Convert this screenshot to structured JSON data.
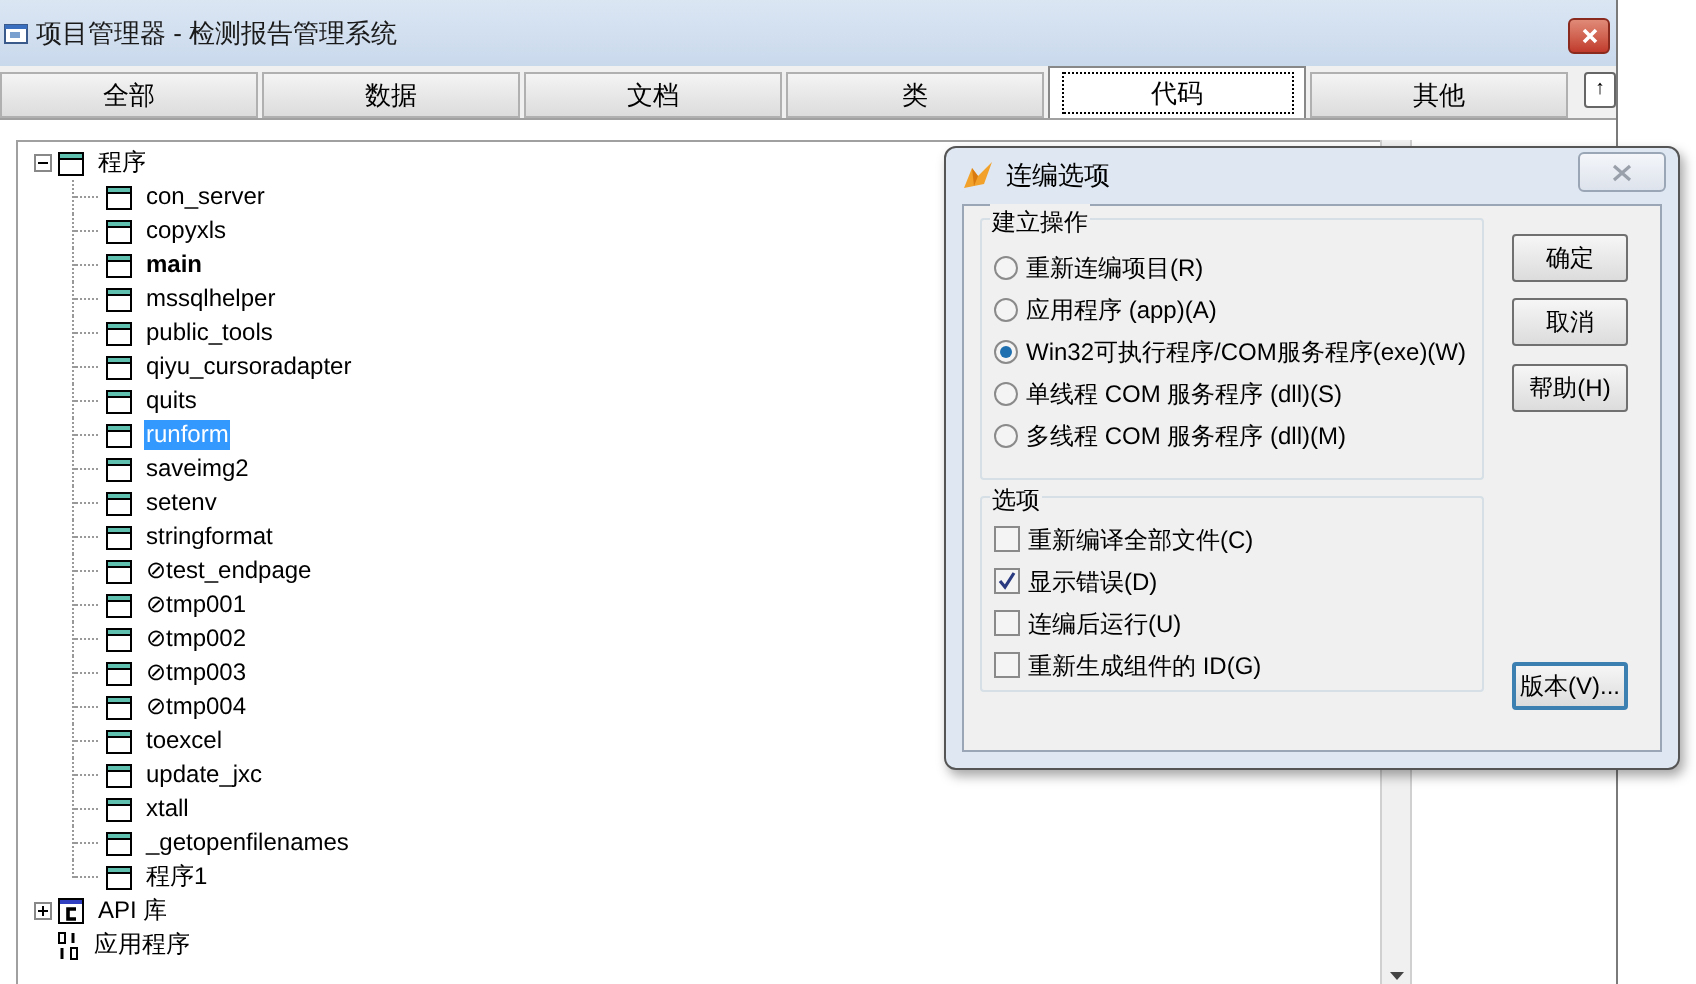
{
  "window": {
    "title": "项目管理器 - 检测报告管理系统"
  },
  "tabs": [
    {
      "label": "全部",
      "selected": false
    },
    {
      "label": "数据",
      "selected": false
    },
    {
      "label": "文档",
      "selected": false
    },
    {
      "label": "类",
      "selected": false
    },
    {
      "label": "代码",
      "selected": true
    },
    {
      "label": "其他",
      "selected": false
    }
  ],
  "collapse_button": {
    "label": "↑"
  },
  "tree": [
    {
      "label": "程序",
      "kind": "folder",
      "expanded": true,
      "selected": false,
      "bold": false,
      "children": [
        {
          "label": "con_server",
          "kind": "program",
          "selected": false,
          "bold": false
        },
        {
          "label": "copyxls",
          "kind": "program",
          "selected": false,
          "bold": false
        },
        {
          "label": "main",
          "kind": "program",
          "selected": false,
          "bold": true
        },
        {
          "label": "mssqlhelper",
          "kind": "program",
          "selected": false,
          "bold": false
        },
        {
          "label": "public_tools",
          "kind": "program",
          "selected": false,
          "bold": false
        },
        {
          "label": "qiyu_cursoradapter",
          "kind": "program",
          "selected": false,
          "bold": false
        },
        {
          "label": "quits",
          "kind": "program",
          "selected": false,
          "bold": false
        },
        {
          "label": "runform",
          "kind": "program",
          "selected": true,
          "bold": false
        },
        {
          "label": "saveimg2",
          "kind": "program",
          "selected": false,
          "bold": false
        },
        {
          "label": "setenv",
          "kind": "program",
          "selected": false,
          "bold": false
        },
        {
          "label": "stringformat",
          "kind": "program",
          "selected": false,
          "bold": false
        },
        {
          "label": "⊘test_endpage",
          "kind": "program",
          "selected": false,
          "bold": false
        },
        {
          "label": "⊘tmp001",
          "kind": "program",
          "selected": false,
          "bold": false
        },
        {
          "label": "⊘tmp002",
          "kind": "program",
          "selected": false,
          "bold": false
        },
        {
          "label": "⊘tmp003",
          "kind": "program",
          "selected": false,
          "bold": false
        },
        {
          "label": "⊘tmp004",
          "kind": "program",
          "selected": false,
          "bold": false
        },
        {
          "label": "toexcel",
          "kind": "program",
          "selected": false,
          "bold": false
        },
        {
          "label": "update_jxc",
          "kind": "program",
          "selected": false,
          "bold": false
        },
        {
          "label": "xtall",
          "kind": "program",
          "selected": false,
          "bold": false
        },
        {
          "label": "_getopenfilenames",
          "kind": "program",
          "selected": false,
          "bold": false
        },
        {
          "label": "程序1",
          "kind": "program",
          "selected": false,
          "bold": false
        }
      ]
    },
    {
      "label": "API 库",
      "kind": "library",
      "expanded": false,
      "selected": false,
      "bold": false
    },
    {
      "label": "应用程序",
      "kind": "app",
      "selected": false,
      "bold": false
    }
  ],
  "dialog": {
    "title": "连编选项",
    "build_group": {
      "title": "建立操作",
      "options": [
        {
          "label": "重新连编项目(R)",
          "selected": false
        },
        {
          "label": "应用程序 (app)(A)",
          "selected": false
        },
        {
          "label": "Win32可执行程序/COM服务程序(exe)(W)",
          "selected": true
        },
        {
          "label": "单线程 COM 服务程序 (dll)(S)",
          "selected": false
        },
        {
          "label": "多线程 COM 服务程序 (dll)(M)",
          "selected": false
        }
      ]
    },
    "options_group": {
      "title": "选项",
      "options": [
        {
          "label": "重新编译全部文件(C)",
          "checked": false
        },
        {
          "label": "显示错误(D)",
          "checked": true
        },
        {
          "label": "连编后运行(U)",
          "checked": false
        },
        {
          "label": "重新生成组件的 ID(G)",
          "checked": false
        }
      ]
    },
    "buttons": [
      {
        "label": "确定",
        "focused": false
      },
      {
        "label": "取消",
        "focused": false
      },
      {
        "label": "帮助(H)",
        "focused": false
      },
      {
        "label": "版本(V)...",
        "focused": true
      }
    ]
  }
}
